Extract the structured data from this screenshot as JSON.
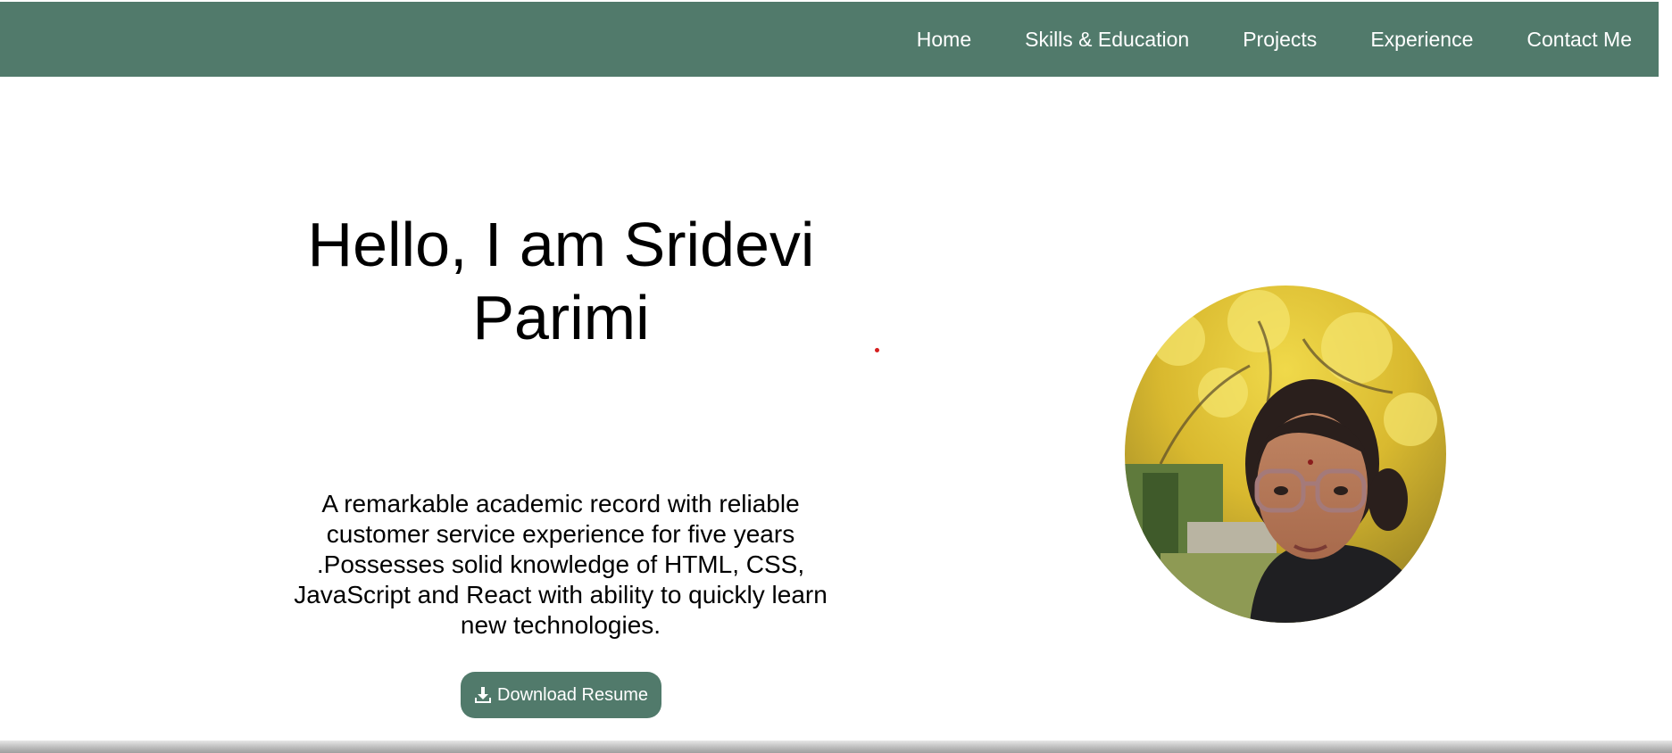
{
  "nav": {
    "items": [
      {
        "label": "Home"
      },
      {
        "label": "Skills & Education"
      },
      {
        "label": "Projects"
      },
      {
        "label": "Experience"
      },
      {
        "label": "Contact Me"
      }
    ]
  },
  "hero": {
    "title": "Hello, I am Sridevi Parimi",
    "description": "A remarkable academic record with reliable customer service experience for five years .Possesses solid knowledge of HTML, CSS, JavaScript and React with ability to quickly learn new technologies.",
    "download_label": "Download Resume",
    "download_icon": "download-icon"
  },
  "profile": {
    "photo_icon": "profile-photo"
  },
  "colors": {
    "navbar": "#517a6b",
    "button": "#517a6b",
    "nav_text": "#ffffff",
    "body_text": "#000000"
  }
}
